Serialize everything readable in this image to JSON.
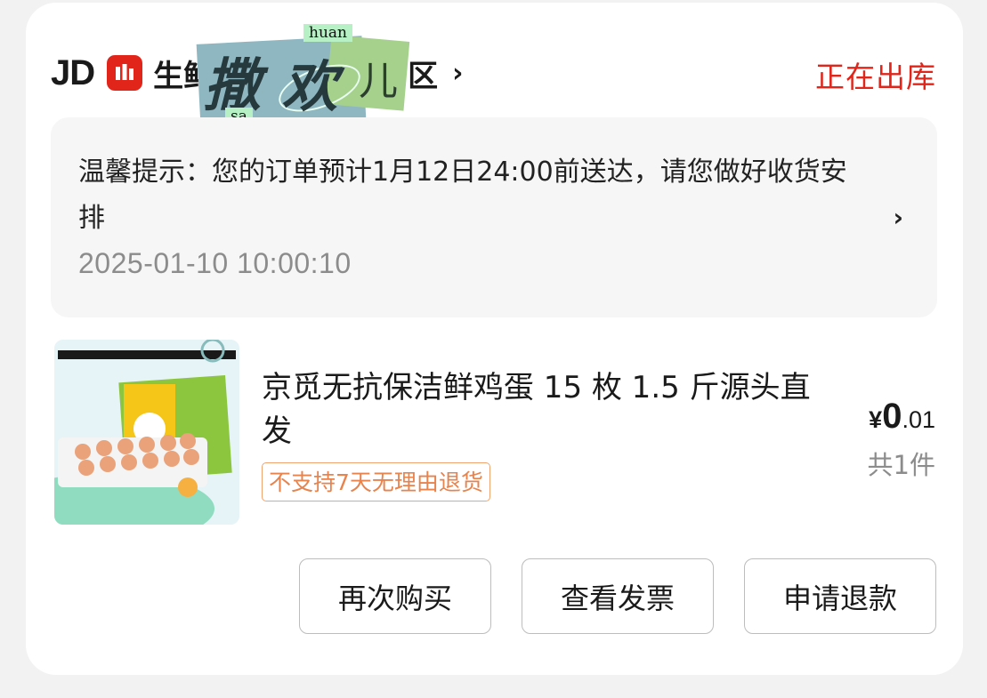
{
  "order": {
    "brand": "JD",
    "store_name": "生鲜",
    "store_name_suffix": "区",
    "store_chevron": "›",
    "status": "正在出库",
    "colors": {
      "accent_red": "#e1251b",
      "tag_orange": "#e9824b"
    }
  },
  "sticker": {
    "pinyin_top": "huan",
    "pinyin_bottom": "sa",
    "char1": "撒",
    "char2": "欢",
    "char3": "儿"
  },
  "notice": {
    "text": "温馨提示：您的订单预计1月12日24:00前送达，请您做好收货安排",
    "timestamp": "2025-01-10 10:00:10",
    "chevron": "›"
  },
  "product": {
    "image_icon": "egg-tray-product-image",
    "title": "京觅无抗保洁鲜鸡蛋 15 枚 1.5 斤源头直发",
    "return_tag": "不支持7天无理由退货",
    "price_symbol": "¥",
    "price_int": "0",
    "price_dec": ".01",
    "quantity": "共1件"
  },
  "actions": {
    "rebuy": "再次购买",
    "invoice": "查看发票",
    "refund": "申请退款"
  }
}
